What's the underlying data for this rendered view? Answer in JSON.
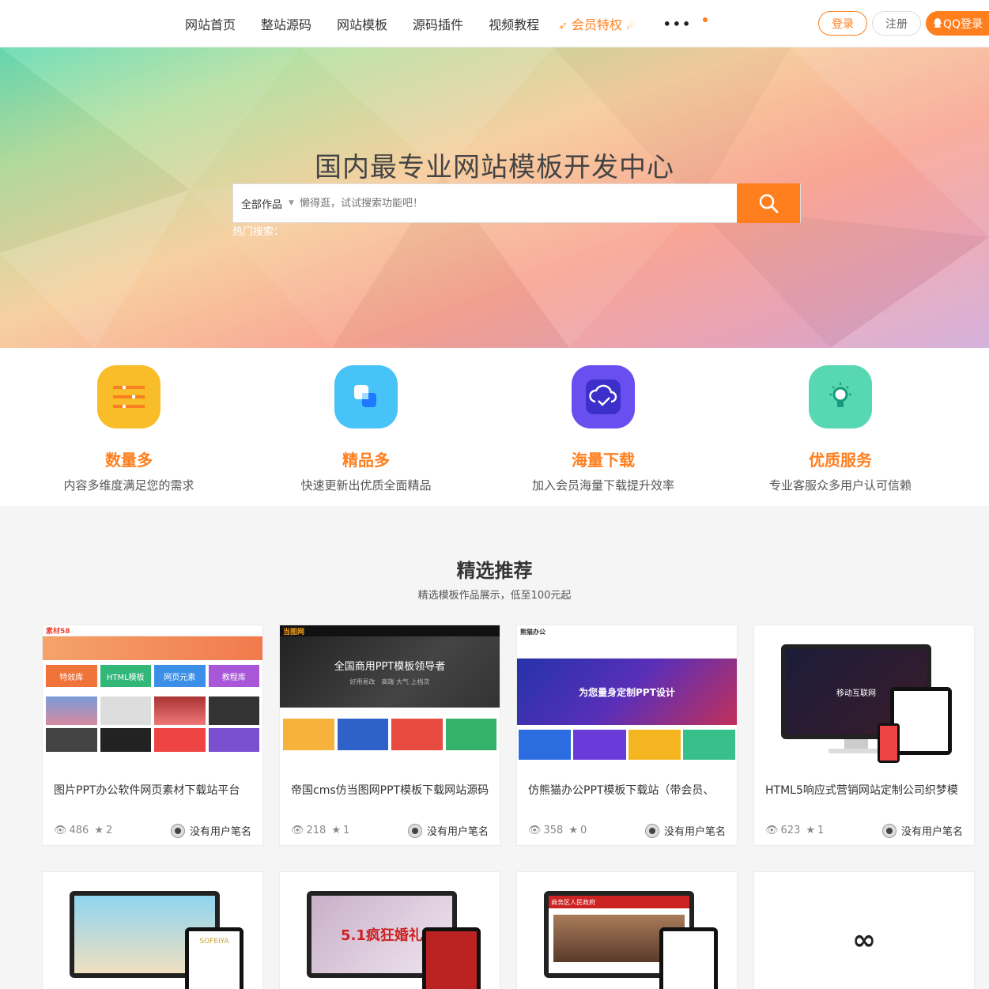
{
  "nav": {
    "items": [
      "网站首页",
      "整站源码",
      "网站模板",
      "源码插件",
      "视频教程"
    ],
    "vip": "会员特权",
    "more": "•••"
  },
  "auth": {
    "login": "登录",
    "register": "注册",
    "qq": "QQ登录"
  },
  "hero": {
    "title": "国内最专业网站模板开发中心",
    "category": "全部作品",
    "search_placeholder": "懒得逛，试试搜索功能吧！",
    "hot": "热门搜索："
  },
  "features": [
    {
      "title": "数量多",
      "desc": "内容多维度满足您的需求",
      "color": "#f8bd29",
      "icon": "list-icon"
    },
    {
      "title": "精品多",
      "desc": "快速更新出优质全面精品",
      "color": "#48c3f8",
      "icon": "layers-icon"
    },
    {
      "title": "海量下载",
      "desc": "加入会员海量下载提升效率",
      "color": "#6a4ff0",
      "icon": "cloud-download-icon"
    },
    {
      "title": "优质服务",
      "desc": "专业客服众多用户认可信赖",
      "color": "#58d8b2",
      "icon": "lightbulb-icon"
    }
  ],
  "section": {
    "title": "精选推荐",
    "subtitle": "精选模板作品展示，低至100元起"
  },
  "cards": [
    {
      "name": "图片PPT办公软件网页素材下载站平台",
      "views": "486",
      "stars": "2",
      "author": "没有用户笔名",
      "thumb_text": [
        "特效库",
        "HTML模板",
        "网页元素",
        "教程库"
      ]
    },
    {
      "name": "帝国cms仿当图网PPT模板下载网站源码",
      "views": "218",
      "stars": "1",
      "author": "没有用户笔名",
      "thumb_text": [
        "当图网",
        "全国商用PPT模板领导者",
        "好用易改　高端 大气 上档次"
      ]
    },
    {
      "name": "仿熊猫办公PPT模板下载站（带会员、",
      "views": "358",
      "stars": "0",
      "author": "没有用户笔名",
      "thumb_text": [
        "熊猫办公",
        "为您量身定制PPT设计"
      ]
    },
    {
      "name": "HTML5响应式营销网站定制公司织梦模",
      "views": "623",
      "stars": "1",
      "author": "没有用户笔名",
      "thumb_text": [
        "移动互联网"
      ]
    }
  ],
  "cards_row2": [
    {
      "thumb_text": "SOFEIYA"
    },
    {
      "thumb_text": "5.1疯狂婚礼"
    },
    {
      "thumb_text": "商务区人民政府"
    },
    {
      "thumb_text": "∞"
    }
  ],
  "colors": {
    "accent": "#ff7f1e"
  }
}
